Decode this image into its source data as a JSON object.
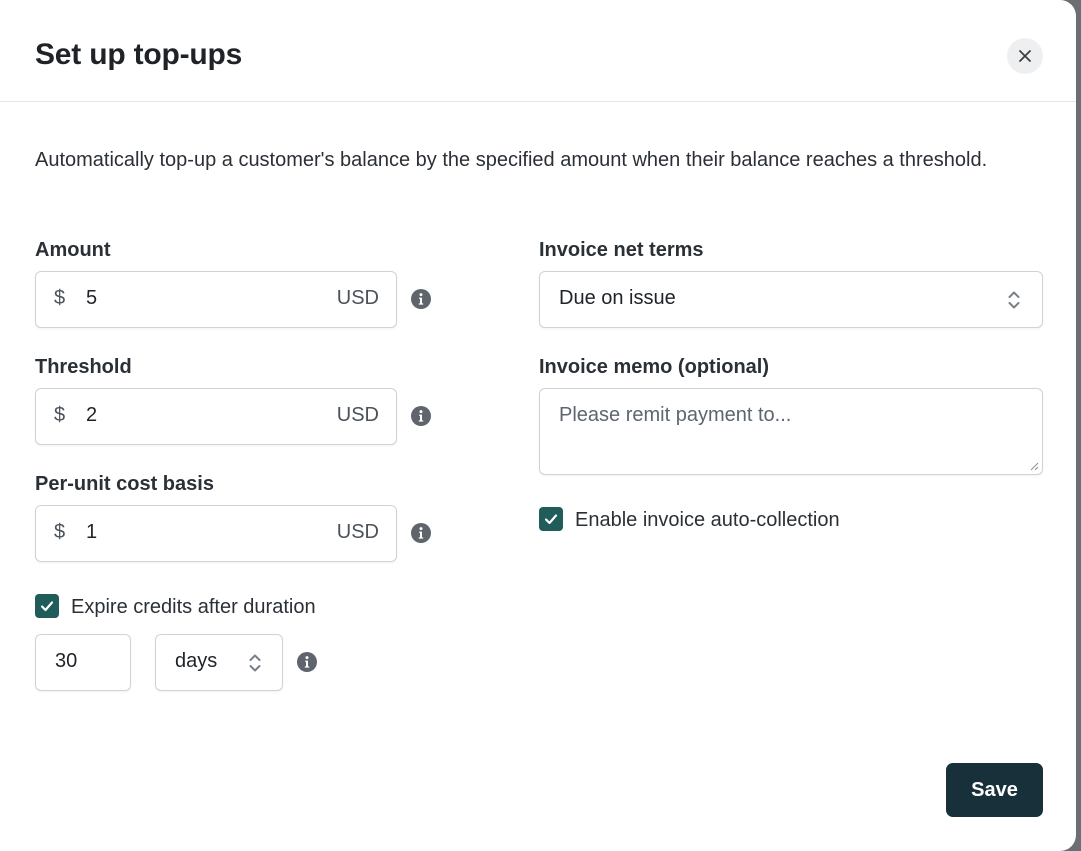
{
  "dialog": {
    "title": "Set up top-ups",
    "description": "Automatically top-up a customer's balance by the specified amount when their balance reaches a threshold."
  },
  "amount": {
    "label": "Amount",
    "currency_symbol": "$",
    "value": "5",
    "unit": "USD"
  },
  "threshold": {
    "label": "Threshold",
    "currency_symbol": "$",
    "value": "2",
    "unit": "USD"
  },
  "cost_basis": {
    "label": "Per-unit cost basis",
    "currency_symbol": "$",
    "value": "1",
    "unit": "USD"
  },
  "expire": {
    "checkbox_label": "Expire credits after duration",
    "checked": true,
    "duration_value": "30",
    "duration_unit": "days"
  },
  "net_terms": {
    "label": "Invoice net terms",
    "selected": "Due on issue"
  },
  "memo": {
    "label": "Invoice memo (optional)",
    "placeholder": "Please remit payment to..."
  },
  "auto_collection": {
    "label": "Enable invoice auto-collection",
    "checked": true
  },
  "actions": {
    "save_label": "Save"
  },
  "colors": {
    "accent": "#1f5c5a",
    "primary_button": "#17303a",
    "border": "#cfd3d8"
  },
  "icons": {
    "close": "close-icon",
    "info": "info-icon",
    "chevron": "chevron-updown-icon",
    "check": "check-icon"
  }
}
